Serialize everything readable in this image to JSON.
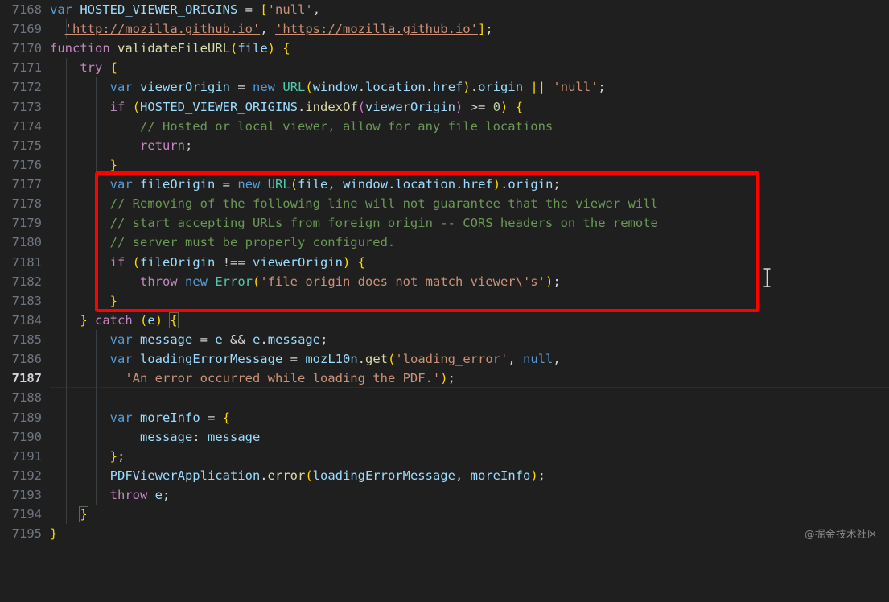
{
  "editor": {
    "background_color": "#1f1f1f",
    "gutter_text_color": "#6e7681",
    "active_line_number": "7187",
    "first_line_number": 7168,
    "annotation": {
      "type": "red-rectangle",
      "color": "#fe0000",
      "covers_lines": "7177-7183"
    },
    "watermark": "@掘金技术社区"
  },
  "lines": [
    {
      "num": "7168",
      "text": "var HOSTED_VIEWER_ORIGINS = ['null',"
    },
    {
      "num": "7169",
      "text": "  'http://mozilla.github.io', 'https://mozilla.github.io'];"
    },
    {
      "num": "7170",
      "text": "function validateFileURL(file) {"
    },
    {
      "num": "7171",
      "text": "    try {"
    },
    {
      "num": "7172",
      "text": "        var viewerOrigin = new URL(window.location.href).origin || 'null';"
    },
    {
      "num": "7173",
      "text": "        if (HOSTED_VIEWER_ORIGINS.indexOf(viewerOrigin) >= 0) {"
    },
    {
      "num": "7174",
      "text": "            // Hosted or local viewer, allow for any file locations"
    },
    {
      "num": "7175",
      "text": "            return;"
    },
    {
      "num": "7176",
      "text": "        }"
    },
    {
      "num": "7177",
      "text": "        var fileOrigin = new URL(file, window.location.href).origin;"
    },
    {
      "num": "7178",
      "text": "        // Removing of the following line will not guarantee that the viewer will"
    },
    {
      "num": "7179",
      "text": "        // start accepting URLs from foreign origin -- CORS headers on the remote"
    },
    {
      "num": "7180",
      "text": "        // server must be properly configured."
    },
    {
      "num": "7181",
      "text": "        if (fileOrigin !== viewerOrigin) {"
    },
    {
      "num": "7182",
      "text": "            throw new Error('file origin does not match viewer\\'s');"
    },
    {
      "num": "7183",
      "text": "        }"
    },
    {
      "num": "7184",
      "text": "    } catch (e) {"
    },
    {
      "num": "7185",
      "text": "        var message = e && e.message;"
    },
    {
      "num": "7186",
      "text": "        var loadingErrorMessage = mozL10n.get('loading_error', null,"
    },
    {
      "num": "7187",
      "text": "          'An error occurred while loading the PDF.');"
    },
    {
      "num": "7188",
      "text": ""
    },
    {
      "num": "7189",
      "text": "        var moreInfo = {"
    },
    {
      "num": "7190",
      "text": "            message: message"
    },
    {
      "num": "7191",
      "text": "        };"
    },
    {
      "num": "7192",
      "text": "        PDFViewerApplication.error(loadingErrorMessage, moreInfo);"
    },
    {
      "num": "7193",
      "text": "        throw e;"
    },
    {
      "num": "7194",
      "text": "    }"
    },
    {
      "num": "7195",
      "text": "}"
    }
  ],
  "colors": {
    "keyword_control": "#c586c0",
    "keyword_decl": "#569cd6",
    "function": "#dcdcaa",
    "class": "#4ec9b0",
    "identifier": "#9cdcfe",
    "string": "#ce9178",
    "comment": "#6a9955",
    "number": "#b5cea8",
    "plain": "#d4d4d4"
  }
}
